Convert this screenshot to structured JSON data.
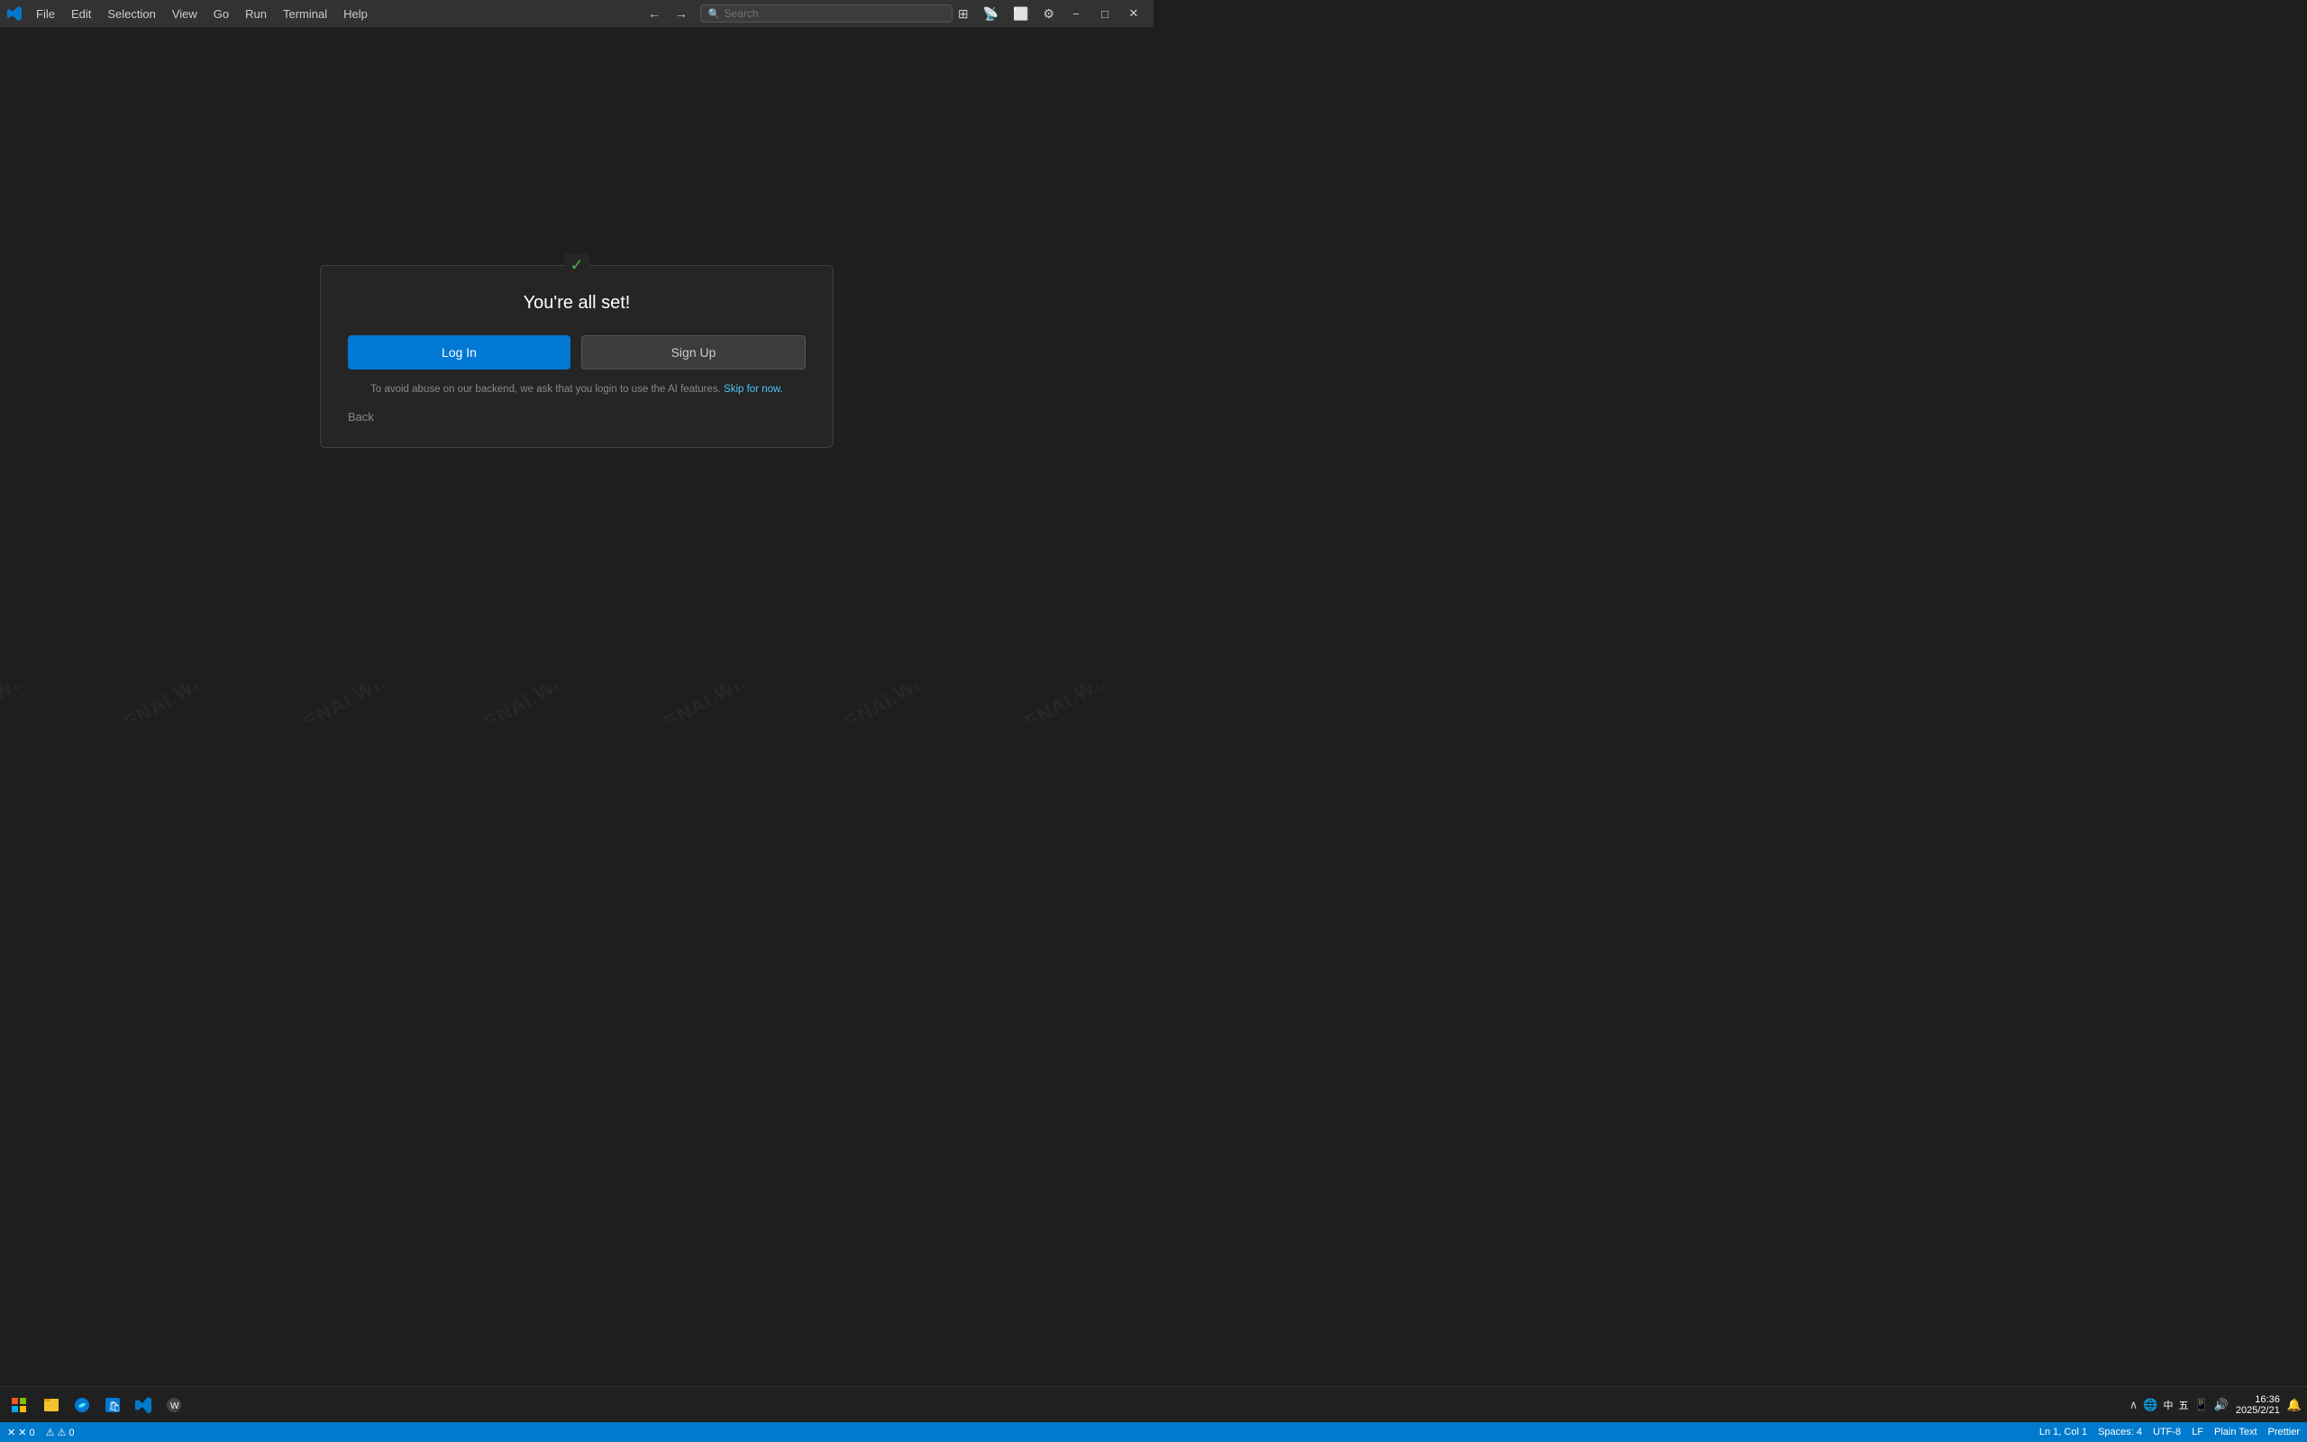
{
  "titlebar": {
    "logo": "VS Code",
    "menu": [
      "File",
      "Edit",
      "Selection",
      "View",
      "Go",
      "Run",
      "Terminal",
      "Help"
    ],
    "search_placeholder": "Search",
    "nav_back": "←",
    "nav_forward": "→",
    "icons": [
      "layout-icon",
      "broadcast-icon",
      "split-icon",
      "settings-icon"
    ],
    "controls": {
      "minimize": "−",
      "maximize": "□",
      "close": "✕"
    }
  },
  "dialog": {
    "title": "You're all set!",
    "login_button": "Log In",
    "signup_button": "Sign Up",
    "note_text": "To avoid abuse on our backend, we ask that you login to use the AI features.",
    "skip_link": "Skip for now.",
    "back_label": "Back"
  },
  "statusbar": {
    "left_items": [
      "✕ 0",
      "⚠ 0"
    ],
    "right_items": [
      "Ln 1, Col 1",
      "Spaces: 4",
      "UTF-8",
      "LF",
      "Plain Text",
      "Prettier"
    ]
  },
  "taskbar": {
    "time": "16:36",
    "date": "2025/2/21",
    "apps": [
      "start",
      "explorer",
      "edge",
      "store",
      "vscode",
      "winget"
    ],
    "sys_icons": [
      "chevron-up",
      "network",
      "lang-zh",
      "keyboard-zh",
      "tablet",
      "volume",
      "notification"
    ]
  },
  "watermark": "OPENAI.WIKI"
}
